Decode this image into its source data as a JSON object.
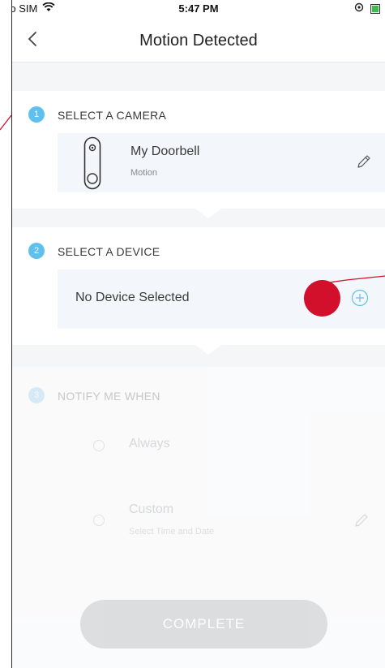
{
  "status_bar": {
    "carrier": "No SIM",
    "time": "5:47 PM"
  },
  "nav": {
    "title": "Motion Detected"
  },
  "steps": [
    {
      "number": "1",
      "label": "SELECT A CAMERA"
    },
    {
      "number": "2",
      "label": "SELECT A DEVICE"
    },
    {
      "number": "3",
      "label": "NOTIFY ME WHEN"
    }
  ],
  "camera": {
    "name": "My Doorbell",
    "subtitle": "Motion"
  },
  "device": {
    "placeholder": "No Device Selected"
  },
  "notify_options": [
    {
      "label": "Always"
    },
    {
      "label": "Custom",
      "subtitle": "Select Time and Date"
    }
  ],
  "complete_button": {
    "label": "COMPLETE"
  },
  "colors": {
    "accent": "#5fc0ee",
    "annotation": "#d2102b",
    "card": "#f3f7fb"
  }
}
